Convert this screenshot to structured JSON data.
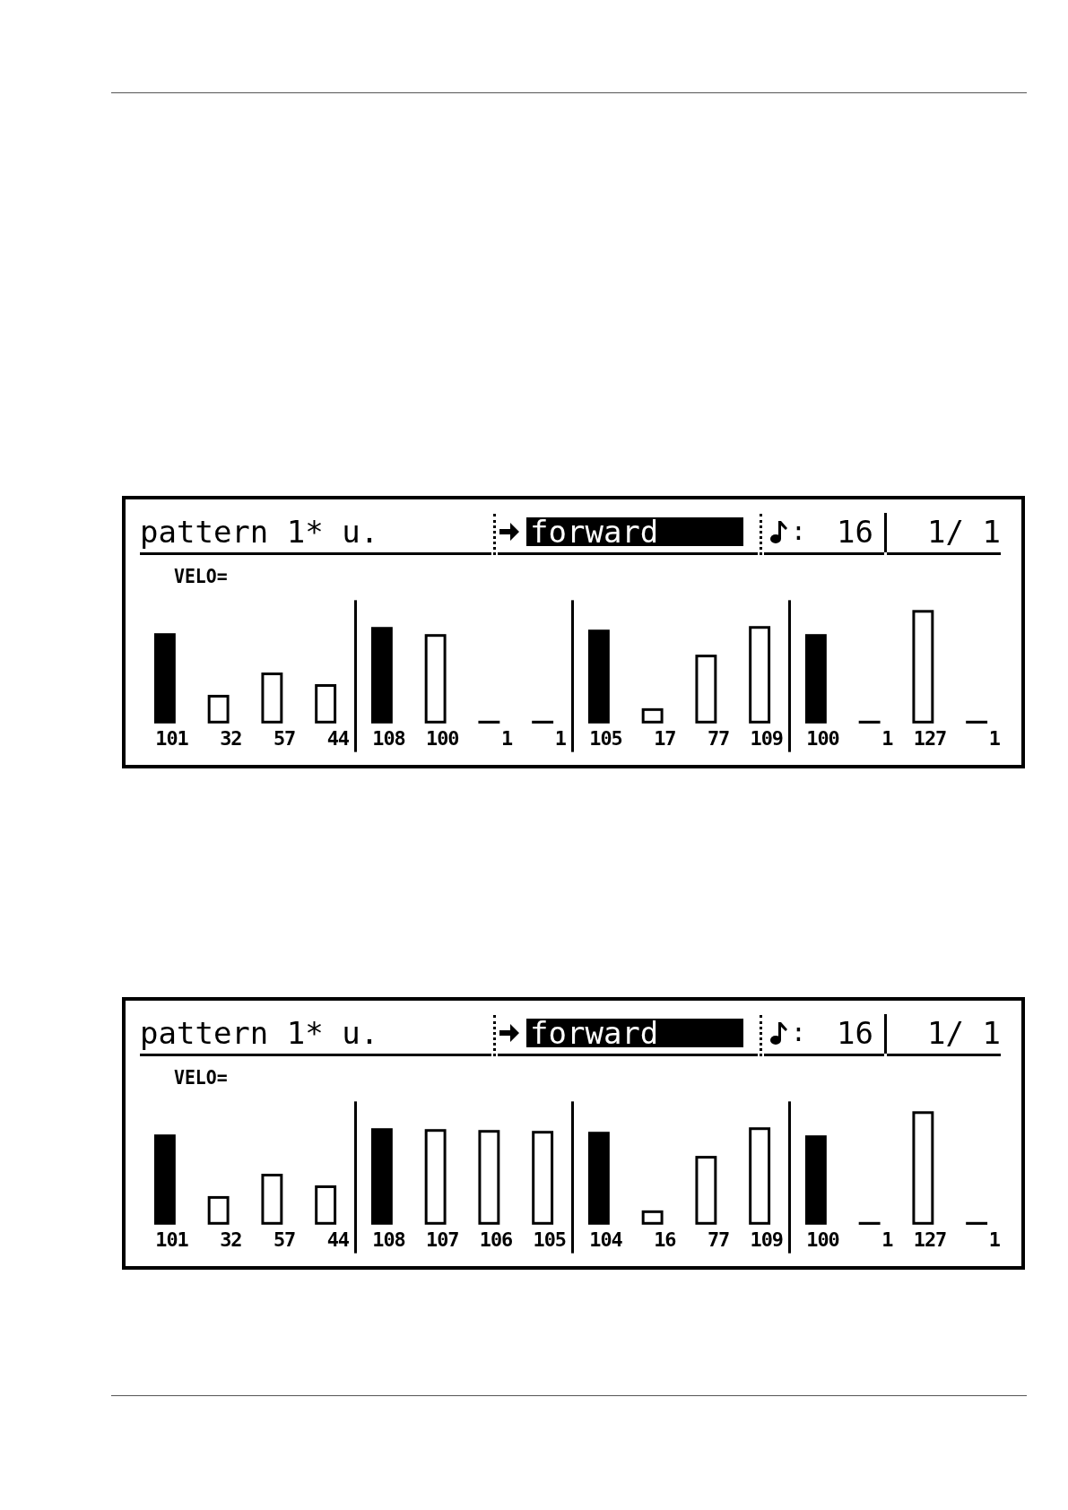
{
  "screens": [
    {
      "header": {
        "title": "pattern 1* u.",
        "mode": {
          "text": "forward",
          "selected": true
        },
        "resolution_colon": ":",
        "resolution": "16",
        "position": "1/ 1"
      },
      "label": "VELO=",
      "steps": [
        {
          "value": "101",
          "accent": true
        },
        {
          "value": "32",
          "accent": false
        },
        {
          "value": "57",
          "accent": false
        },
        {
          "value": "44",
          "accent": false
        },
        {
          "value": "108",
          "accent": true
        },
        {
          "value": "100",
          "accent": false
        },
        {
          "value": "1"
        },
        {
          "value": "1"
        },
        {
          "value": "105",
          "accent": true
        },
        {
          "value": "17",
          "accent": false
        },
        {
          "value": "77",
          "accent": false
        },
        {
          "value": "109",
          "accent": false
        },
        {
          "value": "100",
          "accent": true
        },
        {
          "value": "1"
        },
        {
          "value": "127",
          "accent": false
        },
        {
          "value": "1"
        }
      ]
    },
    {
      "header": {
        "title": "pattern 1* u.",
        "mode": {
          "text": "forward",
          "selected": true
        },
        "resolution_colon": ":",
        "resolution": "16",
        "position": "1/ 1"
      },
      "label": "VELO=",
      "steps": [
        {
          "value": "101",
          "accent": true
        },
        {
          "value": "32",
          "accent": false
        },
        {
          "value": "57",
          "accent": false
        },
        {
          "value": "44",
          "accent": false
        },
        {
          "value": "108",
          "accent": true
        },
        {
          "value": "107",
          "accent": false
        },
        {
          "value": "106",
          "accent": false
        },
        {
          "value": "105",
          "accent": false
        },
        {
          "value": "104",
          "accent": true
        },
        {
          "value": "16",
          "accent": false
        },
        {
          "value": "77",
          "accent": false
        },
        {
          "value": "109",
          "accent": false
        },
        {
          "value": "100",
          "accent": true
        },
        {
          "value": "1"
        },
        {
          "value": "127",
          "accent": false
        },
        {
          "value": "1"
        }
      ]
    }
  ]
}
